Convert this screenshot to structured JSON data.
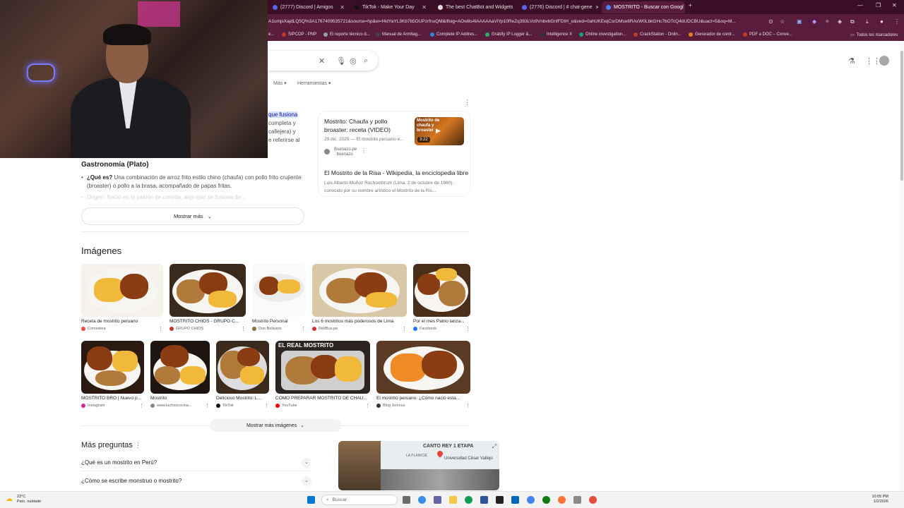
{
  "browser": {
    "tabs": [
      {
        "title": "(2777) Discord | Amigos",
        "color": "#5865f2"
      },
      {
        "title": "TikTok - Make Your Day",
        "color": "#111111"
      },
      {
        "title": "The best ChatBot and Widgets",
        "color": "#e8dde3"
      },
      {
        "title": "(2776) Discord | # chat-gene",
        "color": "#5865f2"
      },
      {
        "title": "MOSTRITO - Buscar con Googl",
        "color": "#4285f4"
      }
    ],
    "new_tab": "+",
    "url": "A1umjsXajdLQ5Q%3A1767409535721&source=hp&ei=f4dYaYL3Kb7b5OUPzrfnuQM&iflsig=AOw8s4IAAAAAaViYp10ReZq393LVo9VnbvbGnfFDIH_o&ved=0ahUKEwjCsrDMse6RAxW0LbkGHc7bOTcQ4dUDCBU&uact=5&oq=M...",
    "bookmarks": [
      {
        "label": "SIPCOP - PNP",
        "color": "#c0392b"
      },
      {
        "label": "El reporte técnico d...",
        "color": "#9e9e9e"
      },
      {
        "label": "Manual de Armitag...",
        "color": "#444444"
      },
      {
        "label": "Complete IP Addres...",
        "color": "#2e86de"
      },
      {
        "label": "Grabify IP Logger &...",
        "color": "#27ae60"
      },
      {
        "label": "Intelligence X",
        "color": "#333333"
      },
      {
        "label": "Online investigation...",
        "color": "#16a085"
      },
      {
        "label": "CrackStation - Onlin...",
        "color": "#c0392b"
      },
      {
        "label": "Generador de contr...",
        "color": "#e67e22"
      },
      {
        "label": "PDF a DOC – Conve...",
        "color": "#c0392b"
      }
    ],
    "all_bookmarks": "Todos los marcadores"
  },
  "search": {
    "filters": {
      "more": "Más",
      "tools": "Herramientas"
    }
  },
  "snippet": {
    "line1_highlight": "que fusiona",
    "line2": "completa y",
    "line3": "callejera) y",
    "line4": "e referirse al"
  },
  "video_card": {
    "title": "Mostrito: Chaufa y pollo broaster: receta (VIDEO)",
    "thumb_text": "Mostrito de chaufa y broaster",
    "duration": "3:22",
    "date": "29 dic. 2025 — El mostrito peruano e...",
    "source_name": "Buenazo.pe",
    "source_sub": "· buenazo",
    "wiki_title": "El Mostrito de la Risa - Wikipedia, la enciclopedia libre",
    "wiki_snippet": "Luis Alberto Muñoz Rochombrum (Lima, 2 de octubre de 1980), conocido por su nombre artístico el Mostrito de la Ris..."
  },
  "knowledge": {
    "title": "Gastronomía (Plato)",
    "bullet_label": "¿Qué es?",
    "bullet_text": " Una combinación de arroz frito estilo chino (chaufa) con pollo frito crujiente (broaster) o pollo a la brasa, acompañado de papas fritas.",
    "faded_text": "Origen: Nació en la pasión de comida, algo que se fusiona de...",
    "show_more": "Mostrar más"
  },
  "images": {
    "heading": "Imágenes",
    "row1": [
      {
        "caption": "Receta de mostrito peruano",
        "source": "Comedera",
        "color": "#e74c3c"
      },
      {
        "caption": "MOSTRITO CHIOS - GRUPO C...",
        "source": "GRUPO CHIOS",
        "color": "#c0392b"
      },
      {
        "caption": "Mostrito Personal",
        "source": "Don Belisario",
        "color": "#8e6e3a"
      },
      {
        "caption": "Los 6 mostritos más poderosos de Lima",
        "source": "RedBus.pe",
        "color": "#d63031"
      },
      {
        "caption": "Por el mes Patrio lanza...",
        "source": "Facebook",
        "color": "#1877f2"
      }
    ],
    "row2": [
      {
        "caption": "MOSTRITO BRO | Nuevo p...",
        "source": "Instagram",
        "color": "#d6249f"
      },
      {
        "caption": "Mostrito",
        "source": "www.luchoscocina...",
        "color": "#7f8c8d"
      },
      {
        "caption": "Delicioso Mostrito: L...",
        "source": "TikTok",
        "color": "#111111"
      },
      {
        "caption": "COMO PREPARAR MOSTRITO DE CHAU...",
        "source": "YouTube",
        "color": "#ff0000",
        "overlay": "EL REAL MOSTRITO"
      },
      {
        "caption": "El mostrito peruano: ¿Cómo nació esta...",
        "source": "Blog Joinnus",
        "color": "#2d3436"
      }
    ],
    "more_button": "Mostrar más imágenes"
  },
  "questions": {
    "heading": "Más preguntas",
    "items": [
      "¿Qué es un mostrito en Perú?",
      "¿Cómo se escribe monstruo o mostrito?"
    ]
  },
  "map": {
    "label": "CANTO REY 1 ETAPA",
    "sub": "LA PLANICIE",
    "place": "Universidad César Vallejo"
  },
  "taskbar": {
    "weather_temp": "23°C",
    "weather_desc": "Parc. nublado",
    "search_placeholder": "Buscar",
    "time": "10:05 PM",
    "date": "1/2/2026"
  }
}
